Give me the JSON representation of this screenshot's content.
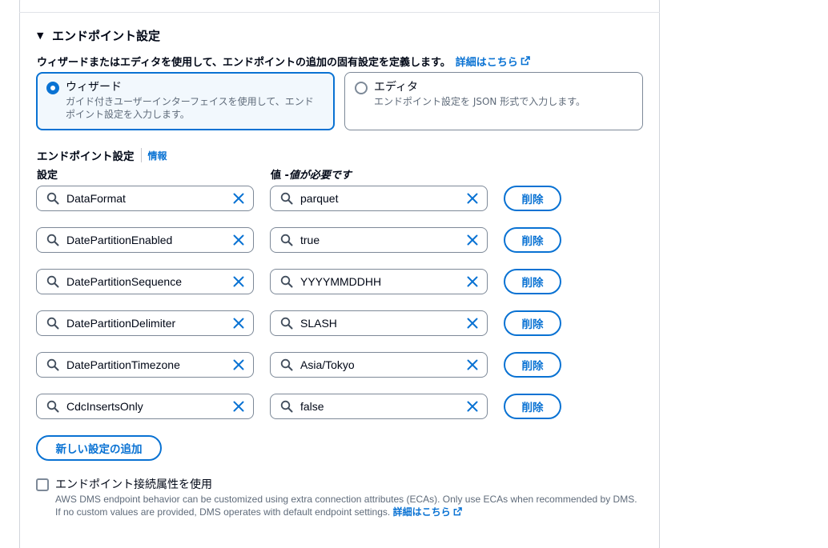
{
  "section": {
    "title": "エンドポイント設定",
    "description": "ウィザードまたはエディタを使用して、エンドポイントの追加の固有設定を定義します。",
    "learn_more": "詳細はこちら"
  },
  "mode": {
    "options": [
      {
        "title": "ウィザード",
        "subtitle_line1": "ガイド付きユーザーインターフェイスを使用して、エンド",
        "subtitle_line2": "ポイント設定を入力します。",
        "selected": true
      },
      {
        "title": "エディタ",
        "subtitle_line1": "エンドポイント設定を JSON 形式で入力します。",
        "subtitle_line2": "",
        "selected": false
      }
    ]
  },
  "settings": {
    "label": "エンドポイント設定",
    "info": "情報",
    "key_header": "設定",
    "value_header_prefix": "値 - ",
    "value_header_note": "値が必要です",
    "delete_label": "削除",
    "rows": [
      {
        "key": "DataFormat",
        "value": "parquet"
      },
      {
        "key": "DatePartitionEnabled",
        "value": "true"
      },
      {
        "key": "DatePartitionSequence",
        "value": "YYYYMMDDHH"
      },
      {
        "key": "DatePartitionDelimiter",
        "value": "SLASH"
      },
      {
        "key": "DatePartitionTimezone",
        "value": "Asia/Tokyo"
      },
      {
        "key": "CdcInsertsOnly",
        "value": "false"
      }
    ],
    "add_label": "新しい設定の追加"
  },
  "eca": {
    "checked": false,
    "title": "エンドポイント接続属性を使用",
    "line1": "AWS DMS endpoint behavior can be customized using extra connection attributes (ECAs). Only use ECAs when recommended by DMS.",
    "line2": "If no custom values are provided, DMS operates with default endpoint settings.",
    "learn_more": "詳細はこちら"
  },
  "colors": {
    "accent": "#0972d3",
    "border": "#7d8998",
    "muted_text": "#5f6b7a"
  }
}
